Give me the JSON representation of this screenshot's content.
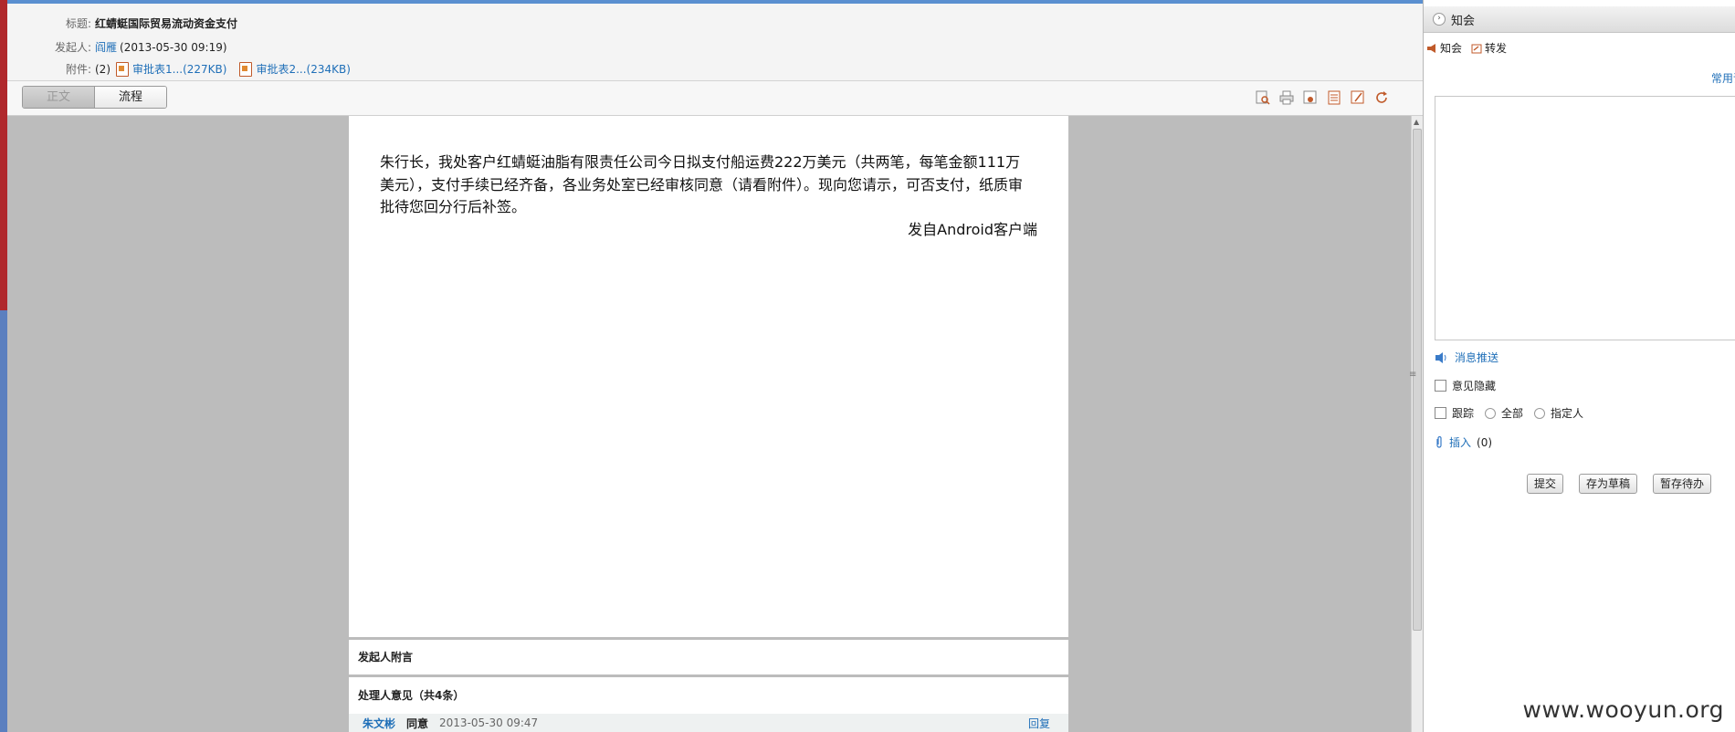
{
  "header": {
    "title_label": "标题:",
    "title_value": "红蜻蜓国际贸易流动资金支付",
    "sender_label": "发起人:",
    "sender_name": "阎雁",
    "sender_time": "(2013-05-30 09:19)",
    "attach_label": "附件:",
    "attach_count": "(2)",
    "attachments": [
      "审批表1...(227KB)",
      "审批表2...(234KB)"
    ]
  },
  "tabs": [
    "正文",
    "流程"
  ],
  "toolbar_icons": [
    "zoom-icon",
    "print-icon",
    "save-icon",
    "doc-icon",
    "edit-icon",
    "refresh-icon"
  ],
  "document": {
    "body": "朱行长，我处客户红蜻蜓油脂有限责任公司今日拟支付船运费222万美元（共两笔，每笔金额111万美元），支付手续已经齐备，各业务处室已经审核同意（请看附件）。现向您请示，可否支付，纸质审批待您回分行后补签。",
    "signature": "发自Android客户端"
  },
  "sections": {
    "sender_note": "发起人附言",
    "opinions": "处理人意见（共4条）"
  },
  "opinion_row": {
    "name": "朱文彬",
    "status": "同意",
    "time": "2013-05-30 09:47",
    "reply": "回复"
  },
  "right_panel": {
    "title": "知会",
    "tab_notify": "知会",
    "tab_forward": "转发",
    "common_phrases": "常用语",
    "message_push": "消息推送",
    "hide_opinion": "意见隐藏",
    "track": "跟踪",
    "track_all": "全部",
    "track_specified": "指定人",
    "insert": "插入",
    "insert_count": "(0)",
    "buttons": [
      "提交",
      "存为草稿",
      "暂存待办"
    ]
  },
  "watermark": "www.wooyun.org",
  "colors": {
    "link": "#1f6fb8",
    "doc_bg": "#bcbcbc",
    "accent_icon": "#c05a2a"
  }
}
